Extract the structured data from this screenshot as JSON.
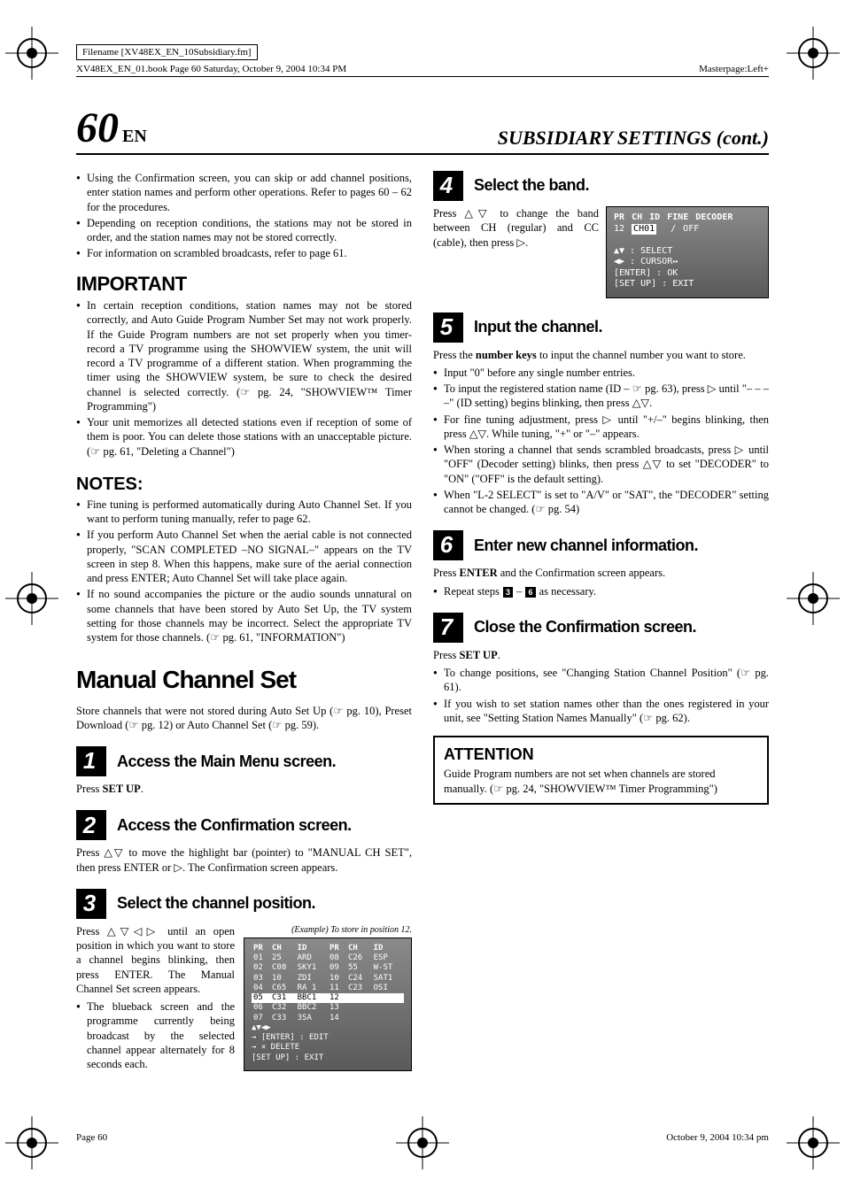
{
  "filename_box": "Filename [XV48EX_EN_10Subsidiary.fm]",
  "header_left": "XV48EX_EN_01.book  Page 60  Saturday, October 9, 2004  10:34 PM",
  "header_right": "Masterpage:Left+",
  "page_number": "60",
  "page_number_suffix": "EN",
  "section_title": "SUBSIDIARY SETTINGS (cont.)",
  "left_intro_bullets": [
    "Using the Confirmation screen, you can skip or add channel positions, enter station names and perform other operations. Refer to pages 60 – 62 for the procedures.",
    "Depending on reception conditions, the stations may not be stored in order, and the station names may not be stored correctly.",
    "For information on scrambled broadcasts, refer to page 61."
  ],
  "important_title": "IMPORTANT",
  "important_bullets": [
    "In certain reception conditions, station names may not be stored correctly, and Auto Guide Program Number Set may not work properly. If the Guide Program numbers are not set properly when you timer-record a TV programme using the SHOWVIEW system, the unit will record a TV programme of a different station. When programming the timer using the SHOWVIEW system, be sure to check the desired channel is selected correctly. (☞ pg. 24, \"SHOWVIEW™ Timer Programming\")",
    "Your unit memorizes all detected stations even if reception of some of them is poor. You can delete those stations with an unacceptable picture. (☞ pg. 61, \"Deleting a Channel\")"
  ],
  "notes_title": "NOTES:",
  "notes_bullets": [
    "Fine tuning is performed automatically during Auto Channel Set. If you want to perform tuning manually, refer to page 62.",
    "If you perform Auto Channel Set when the aerial cable is not connected properly, \"SCAN COMPLETED –NO SIGNAL–\" appears on the TV screen in step 8. When this happens, make sure of the aerial connection and press ENTER; Auto Channel Set will take place again.",
    "If no sound accompanies the picture or the audio sounds unnatural on some channels that have been stored by Auto Set Up, the TV system setting for those channels may be incorrect. Select the appropriate TV system for those channels. (☞ pg. 61, \"INFORMATION\")"
  ],
  "manual_title": "Manual Channel Set",
  "manual_intro": "Store channels that were not stored during Auto Set Up (☞ pg. 10), Preset Download (☞ pg. 12) or Auto Channel Set (☞ pg. 59).",
  "step1_title": "Access the Main Menu screen.",
  "step1_body": "Press SET UP.",
  "step2_title": "Access the Confirmation screen.",
  "step2_body": "Press △▽ to move the highlight bar (pointer) to \"MANUAL CH SET\", then press ENTER or ▷. The Confirmation screen appears.",
  "step3_title": "Select the channel position.",
  "step3_body": "Press △▽◁▷ until an open position in which you want to store a channel begins blinking, then press ENTER. The Manual Channel Set screen appears.",
  "step3_bullet": "The blueback screen and the programme currently being broadcast by the selected channel appear alternately for 8 seconds each.",
  "step3_caption": "(Example) To store in position 12.",
  "osd_table": {
    "headers_left": [
      "PR",
      "CH",
      "ID"
    ],
    "headers_right": [
      "PR",
      "CH",
      "ID"
    ],
    "rows": [
      [
        "01",
        "25",
        "ARD",
        "08",
        "C26",
        "ESP"
      ],
      [
        "02",
        "C08",
        "SKY1",
        "09",
        "55",
        "W-ST"
      ],
      [
        "03",
        "10",
        "ZDI",
        "10",
        "C24",
        "SAT1"
      ],
      [
        "04",
        "C65",
        "RA 1",
        "11",
        "C23",
        "OSI"
      ],
      [
        "05",
        "C31",
        "BBC1",
        "12",
        "",
        ""
      ],
      [
        "06",
        "C32",
        "BBC2",
        "13",
        "",
        ""
      ],
      [
        "07",
        "C33",
        "3SA",
        "14",
        "",
        ""
      ]
    ],
    "highlight_row_index": 4,
    "footer": [
      "▲▼◀▶",
      "→ [ENTER] : EDIT",
      "→  ×   DELETE",
      "[SET UP] : EXIT"
    ]
  },
  "step4_title": "Select the band.",
  "step4_body": "Press △▽ to change the band between CH (regular) and CC (cable), then press ▷.",
  "osd_single": {
    "header": [
      "PR",
      "CH",
      "ID",
      "FINE",
      "DECODER"
    ],
    "row": [
      "12",
      "CH01",
      "",
      "/",
      "OFF"
    ],
    "highlight": "CH",
    "footer": [
      "▲▼  : SELECT",
      "◀▶  : CURSOR↔",
      "[ENTER] : OK",
      "[SET UP] : EXIT"
    ]
  },
  "step5_title": "Input the channel.",
  "step5_body": "Press the number keys to input the channel number you want to store.",
  "step5_bullets": [
    "Input \"0\" before any single number entries.",
    "To input the registered station name (ID – ☞ pg. 63), press ▷ until \"– – – –\" (ID setting) begins blinking, then press △▽.",
    "For fine tuning adjustment, press ▷ until \"+/–\" begins blinking, then press △▽. While tuning, \"+\" or \"–\" appears.",
    "When storing a channel that sends scrambled broadcasts, press ▷ until \"OFF\" (Decoder setting) blinks, then press △▽ to set \"DECODER\" to \"ON\" (\"OFF\" is the default setting).",
    "When \"L-2 SELECT\" is set to \"A/V\" or \"SAT\", the \"DECODER\" setting cannot be changed. (☞ pg. 54)"
  ],
  "step6_title": "Enter new channel information.",
  "step6_body": "Press ENTER and the Confirmation screen appears.",
  "step6_bullet": "Repeat steps 3 – 6 as necessary.",
  "step7_title": "Close the Confirmation screen.",
  "step7_body": "Press SET UP.",
  "step7_bullets": [
    "To change positions, see \"Changing Station Channel Position\" (☞ pg. 61).",
    "If you wish to set station names other than the ones registered in your unit, see \"Setting Station Names Manually\" (☞ pg. 62)."
  ],
  "attention_title": "ATTENTION",
  "attention_body": "Guide Program numbers are not set when channels are stored manually. (☞ pg. 24, \"SHOWVIEW™ Timer Programming\")",
  "footer_left": "Page 60",
  "footer_right": "October 9, 2004 10:34 pm"
}
